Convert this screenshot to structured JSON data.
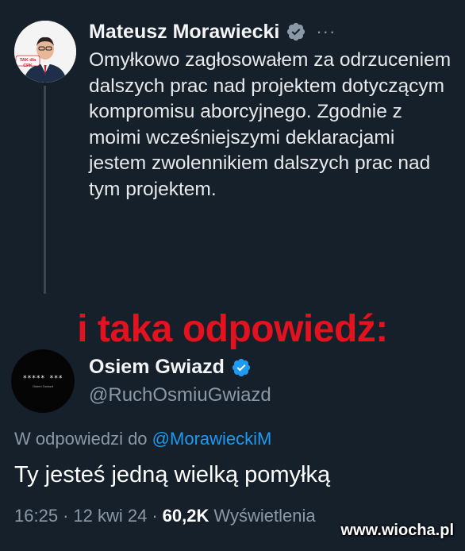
{
  "tweet": {
    "author_name": "Mateusz Morawiecki",
    "more_icon": "ellipsis-icon",
    "avatar_badge": "TAK dla CPK",
    "body": "Omyłkowo zagłosowałem za odrzuceniem dalszych prac nad projektem dotyczącym kompromisu aborcyjnego. Zgodnie z moimi wcześniejszymi deklaracjami jestem zwolennikiem dalszych prac nad tym projektem.",
    "verified_color": "#8b98a5"
  },
  "banner": {
    "text": "i taka odpowiedź:",
    "color": "#e4111f"
  },
  "reply": {
    "author_name": "Osiem Gwiazd",
    "handle": "@RuchOsmiuGwiazd",
    "avatar_stars": "***** ***",
    "avatar_sub": "Osiem Gwiazd",
    "verified_color": "#1d9bf0",
    "replying_to_prefix": "W odpowiedzi do",
    "replying_to_mention": "@MorawieckiM",
    "text": "Ty jesteś jedną wielką pomyłką",
    "time": "16:25",
    "separator": "·",
    "date": "12 kwi 24",
    "views_count": "60,2K",
    "views_label": "Wyświetlenia"
  },
  "watermark": "www.wiocha.pl",
  "colors": {
    "background": "#15202b",
    "link": "#1d9bf0",
    "secondary": "#8b98a5"
  }
}
